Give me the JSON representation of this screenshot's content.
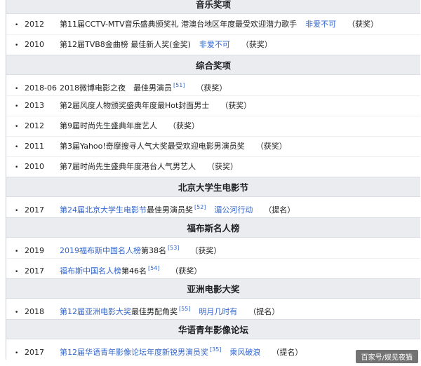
{
  "sections": [
    {
      "title": "音乐奖项",
      "rows": [
        {
          "year": "2012",
          "parts": [
            {
              "t": "第11届CCTV-MTV音乐盛典颁奖礼 港澳台地区年度最受欢迎潜力歌手",
              "link": false
            }
          ],
          "work": "非爱不可",
          "work_link": true,
          "ref": "",
          "result": "（获奖）"
        },
        {
          "year": "2010",
          "parts": [
            {
              "t": "第12届TVB8金曲榜 最佳新人奖(金奖)",
              "link": false
            }
          ],
          "work": "非爱不可",
          "work_link": true,
          "ref": "",
          "result": "（获奖）"
        }
      ]
    },
    {
      "title": "综合奖项",
      "rows": [
        {
          "year": "2018-06",
          "parts": [
            {
              "t": "2018微博电影之夜　最佳男演员",
              "link": false
            }
          ],
          "work": "",
          "work_link": false,
          "ref": "[51]",
          "result": "（获奖）"
        },
        {
          "year": "2013",
          "parts": [
            {
              "t": "第2届风度人物颁奖盛典年度最Hot封面男士",
              "link": false
            }
          ],
          "work": "",
          "work_link": false,
          "ref": "",
          "result": "（获奖）"
        },
        {
          "year": "2012",
          "parts": [
            {
              "t": "第9届时尚先生盛典年度艺人",
              "link": false
            }
          ],
          "work": "",
          "work_link": false,
          "ref": "",
          "result": "（获奖）"
        },
        {
          "year": "2011",
          "parts": [
            {
              "t": "第3届Yahoo!奇摩搜寻人气大奖最受欢迎电影男演员奖",
              "link": false
            }
          ],
          "work": "",
          "work_link": false,
          "ref": "",
          "result": "（获奖）"
        },
        {
          "year": "2010",
          "parts": [
            {
              "t": "第7届时尚先生盛典年度港台人气男艺人",
              "link": false
            }
          ],
          "work": "",
          "work_link": false,
          "ref": "",
          "result": "（获奖）"
        }
      ]
    },
    {
      "title": "北京大学生电影节",
      "rows": [
        {
          "year": "2017",
          "parts": [
            {
              "t": "第24届北京大学生电影节",
              "link": true
            },
            {
              "t": "最佳男演员奖",
              "link": false
            }
          ],
          "work": "湄公河行动",
          "work_link": true,
          "ref": "[52]",
          "result": "（提名）"
        }
      ]
    },
    {
      "title": "福布斯名人榜",
      "rows": [
        {
          "year": "2019",
          "parts": [
            {
              "t": "2019福布斯中国名人榜",
              "link": true
            },
            {
              "t": "第38名",
              "link": false
            }
          ],
          "work": "",
          "work_link": false,
          "ref": "[53]",
          "result": "（获奖）"
        },
        {
          "year": "2017",
          "parts": [
            {
              "t": "福布斯中国名人榜",
              "link": true
            },
            {
              "t": "第46名",
              "link": false
            }
          ],
          "work": "",
          "work_link": false,
          "ref": "[54]",
          "result": "（获奖）"
        }
      ]
    },
    {
      "title": "亚洲电影大奖",
      "rows": [
        {
          "year": "2018",
          "parts": [
            {
              "t": "第12届亚洲电影大奖",
              "link": true
            },
            {
              "t": "最佳男配角奖",
              "link": false
            }
          ],
          "work": "明月几时有",
          "work_link": true,
          "ref": "[55]",
          "result": "（提名）"
        }
      ]
    },
    {
      "title": "华语青年影像论坛",
      "rows": [
        {
          "year": "2017",
          "parts": [
            {
              "t": "第12届华语青年影像论坛年度新锐男演员奖",
              "link": true
            }
          ],
          "work": "乘风破浪",
          "work_link": true,
          "ref": "[35]",
          "result": "（提名）"
        }
      ]
    }
  ],
  "watermark": "百家号/娱见夜猫"
}
